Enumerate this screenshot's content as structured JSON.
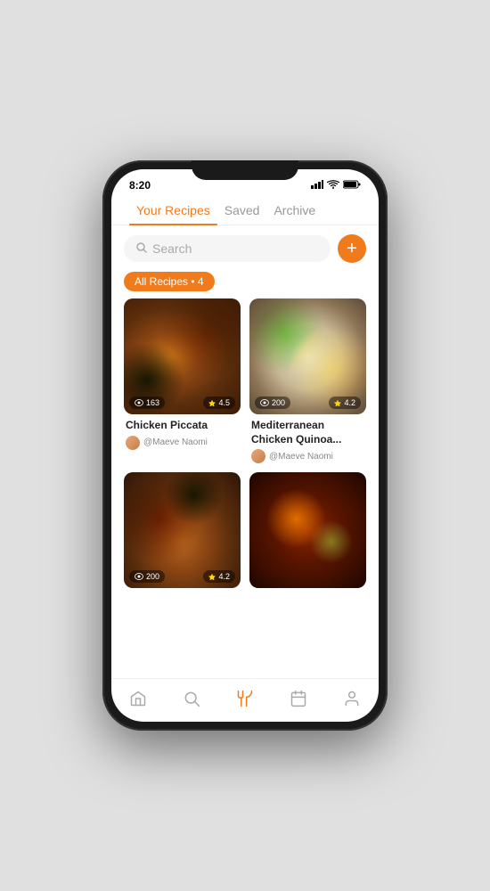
{
  "phone": {
    "status_bar": {
      "time": "8:20",
      "signal_icon": "▲▲▲",
      "wifi_icon": "wifi",
      "battery_icon": "battery"
    }
  },
  "tabs": [
    {
      "label": "Your Recipes",
      "active": true
    },
    {
      "label": "Saved",
      "active": false
    },
    {
      "label": "Archive",
      "active": false
    }
  ],
  "search": {
    "placeholder": "Search"
  },
  "add_button_label": "+",
  "filter_chip": {
    "label": "All Recipes • 4"
  },
  "recipes": [
    {
      "title": "Chicken Piccata",
      "author": "@Maeve Naomi",
      "views": "163",
      "rating": "4.5",
      "food_class": "food-chicken-piccata"
    },
    {
      "title": "Mediterranean Chicken Quinoa...",
      "author": "@Maeve Naomi",
      "views": "200",
      "rating": "4.2",
      "food_class": "food-mediterranean"
    },
    {
      "title": "",
      "author": "",
      "views": "200",
      "rating": "4.2",
      "food_class": "food-pan-chicken"
    },
    {
      "title": "",
      "author": "",
      "views": "",
      "rating": "",
      "food_class": "food-stew"
    }
  ],
  "bottom_nav": [
    {
      "icon": "home",
      "label": "home",
      "active": false
    },
    {
      "icon": "search",
      "label": "search",
      "active": false
    },
    {
      "icon": "fork",
      "label": "recipes",
      "active": true
    },
    {
      "icon": "calendar",
      "label": "calendar",
      "active": false
    },
    {
      "icon": "profile",
      "label": "profile",
      "active": false
    }
  ]
}
